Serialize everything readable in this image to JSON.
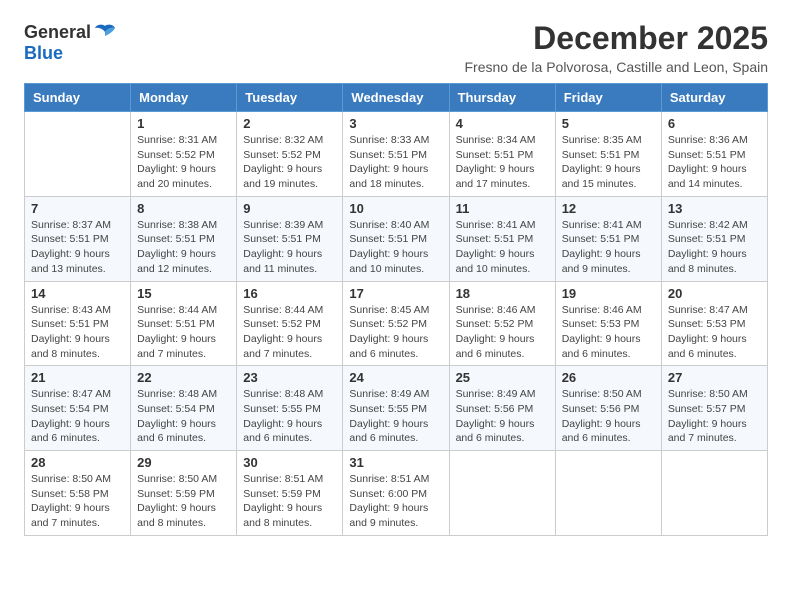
{
  "logo": {
    "general": "General",
    "blue": "Blue"
  },
  "header": {
    "title": "December 2025",
    "subtitle": "Fresno de la Polvorosa, Castille and Leon, Spain"
  },
  "calendar": {
    "columns": [
      "Sunday",
      "Monday",
      "Tuesday",
      "Wednesday",
      "Thursday",
      "Friday",
      "Saturday"
    ],
    "weeks": [
      [
        {
          "day": "",
          "info": ""
        },
        {
          "day": "1",
          "info": "Sunrise: 8:31 AM\nSunset: 5:52 PM\nDaylight: 9 hours\nand 20 minutes."
        },
        {
          "day": "2",
          "info": "Sunrise: 8:32 AM\nSunset: 5:52 PM\nDaylight: 9 hours\nand 19 minutes."
        },
        {
          "day": "3",
          "info": "Sunrise: 8:33 AM\nSunset: 5:51 PM\nDaylight: 9 hours\nand 18 minutes."
        },
        {
          "day": "4",
          "info": "Sunrise: 8:34 AM\nSunset: 5:51 PM\nDaylight: 9 hours\nand 17 minutes."
        },
        {
          "day": "5",
          "info": "Sunrise: 8:35 AM\nSunset: 5:51 PM\nDaylight: 9 hours\nand 15 minutes."
        },
        {
          "day": "6",
          "info": "Sunrise: 8:36 AM\nSunset: 5:51 PM\nDaylight: 9 hours\nand 14 minutes."
        }
      ],
      [
        {
          "day": "7",
          "info": "Sunrise: 8:37 AM\nSunset: 5:51 PM\nDaylight: 9 hours\nand 13 minutes."
        },
        {
          "day": "8",
          "info": "Sunrise: 8:38 AM\nSunset: 5:51 PM\nDaylight: 9 hours\nand 12 minutes."
        },
        {
          "day": "9",
          "info": "Sunrise: 8:39 AM\nSunset: 5:51 PM\nDaylight: 9 hours\nand 11 minutes."
        },
        {
          "day": "10",
          "info": "Sunrise: 8:40 AM\nSunset: 5:51 PM\nDaylight: 9 hours\nand 10 minutes."
        },
        {
          "day": "11",
          "info": "Sunrise: 8:41 AM\nSunset: 5:51 PM\nDaylight: 9 hours\nand 10 minutes."
        },
        {
          "day": "12",
          "info": "Sunrise: 8:41 AM\nSunset: 5:51 PM\nDaylight: 9 hours\nand 9 minutes."
        },
        {
          "day": "13",
          "info": "Sunrise: 8:42 AM\nSunset: 5:51 PM\nDaylight: 9 hours\nand 8 minutes."
        }
      ],
      [
        {
          "day": "14",
          "info": "Sunrise: 8:43 AM\nSunset: 5:51 PM\nDaylight: 9 hours\nand 8 minutes."
        },
        {
          "day": "15",
          "info": "Sunrise: 8:44 AM\nSunset: 5:51 PM\nDaylight: 9 hours\nand 7 minutes."
        },
        {
          "day": "16",
          "info": "Sunrise: 8:44 AM\nSunset: 5:52 PM\nDaylight: 9 hours\nand 7 minutes."
        },
        {
          "day": "17",
          "info": "Sunrise: 8:45 AM\nSunset: 5:52 PM\nDaylight: 9 hours\nand 6 minutes."
        },
        {
          "day": "18",
          "info": "Sunrise: 8:46 AM\nSunset: 5:52 PM\nDaylight: 9 hours\nand 6 minutes."
        },
        {
          "day": "19",
          "info": "Sunrise: 8:46 AM\nSunset: 5:53 PM\nDaylight: 9 hours\nand 6 minutes."
        },
        {
          "day": "20",
          "info": "Sunrise: 8:47 AM\nSunset: 5:53 PM\nDaylight: 9 hours\nand 6 minutes."
        }
      ],
      [
        {
          "day": "21",
          "info": "Sunrise: 8:47 AM\nSunset: 5:54 PM\nDaylight: 9 hours\nand 6 minutes."
        },
        {
          "day": "22",
          "info": "Sunrise: 8:48 AM\nSunset: 5:54 PM\nDaylight: 9 hours\nand 6 minutes."
        },
        {
          "day": "23",
          "info": "Sunrise: 8:48 AM\nSunset: 5:55 PM\nDaylight: 9 hours\nand 6 minutes."
        },
        {
          "day": "24",
          "info": "Sunrise: 8:49 AM\nSunset: 5:55 PM\nDaylight: 9 hours\nand 6 minutes."
        },
        {
          "day": "25",
          "info": "Sunrise: 8:49 AM\nSunset: 5:56 PM\nDaylight: 9 hours\nand 6 minutes."
        },
        {
          "day": "26",
          "info": "Sunrise: 8:50 AM\nSunset: 5:56 PM\nDaylight: 9 hours\nand 6 minutes."
        },
        {
          "day": "27",
          "info": "Sunrise: 8:50 AM\nSunset: 5:57 PM\nDaylight: 9 hours\nand 7 minutes."
        }
      ],
      [
        {
          "day": "28",
          "info": "Sunrise: 8:50 AM\nSunset: 5:58 PM\nDaylight: 9 hours\nand 7 minutes."
        },
        {
          "day": "29",
          "info": "Sunrise: 8:50 AM\nSunset: 5:59 PM\nDaylight: 9 hours\nand 8 minutes."
        },
        {
          "day": "30",
          "info": "Sunrise: 8:51 AM\nSunset: 5:59 PM\nDaylight: 9 hours\nand 8 minutes."
        },
        {
          "day": "31",
          "info": "Sunrise: 8:51 AM\nSunset: 6:00 PM\nDaylight: 9 hours\nand 9 minutes."
        },
        {
          "day": "",
          "info": ""
        },
        {
          "day": "",
          "info": ""
        },
        {
          "day": "",
          "info": ""
        }
      ]
    ]
  }
}
